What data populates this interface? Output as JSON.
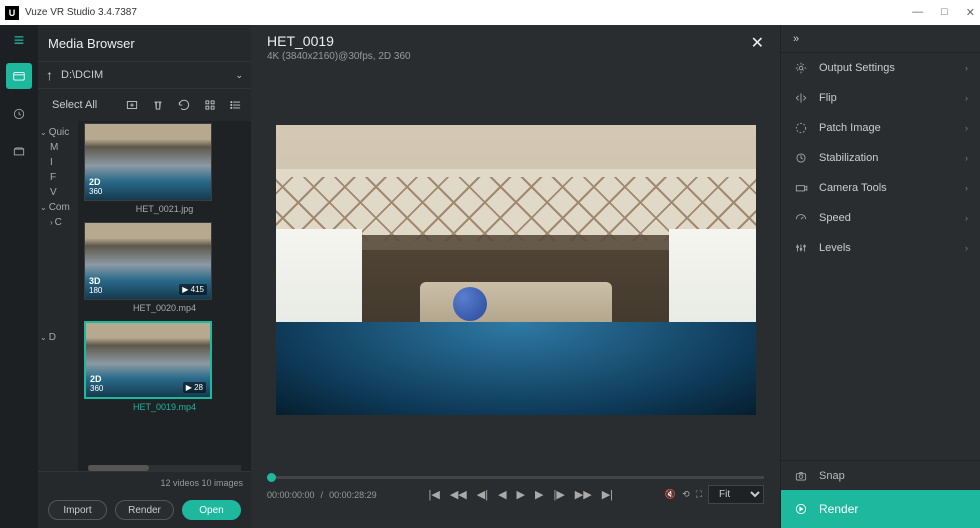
{
  "title_bar": {
    "app_name": "Vuze VR Studio 3.4.7387"
  },
  "browser": {
    "title": "Media Browser",
    "path": "D:\\DCIM",
    "select_all": "Select All",
    "tree": [
      "Quic",
      "M",
      "I",
      "F",
      "V",
      "Com",
      "C",
      "D"
    ],
    "thumbs": [
      {
        "name": "HET_0021.jpg",
        "badge": "2D",
        "sub": "360",
        "play": "",
        "sel": false
      },
      {
        "name": "HET_0020.mp4",
        "badge": "3D",
        "sub": "180",
        "play": "▶ 415",
        "sel": false
      },
      {
        "name": "HET_0019.mp4",
        "badge": "2D",
        "sub": "360",
        "play": "▶ 28",
        "sel": true
      }
    ],
    "footer": "12 videos  10 images",
    "import": "Import",
    "render": "Render",
    "open": "Open"
  },
  "viewer": {
    "title": "HET_0019",
    "subtitle": "4K (3840x2160)@30fps, 2D 360",
    "time_cur": "00:00:00:00",
    "time_dur": "00:00:28:29",
    "fit": "Fit"
  },
  "right": {
    "items": [
      {
        "icon": "gear",
        "label": "Output Settings"
      },
      {
        "icon": "flip",
        "label": "Flip"
      },
      {
        "icon": "patch",
        "label": "Patch Image"
      },
      {
        "icon": "stab",
        "label": "Stabilization"
      },
      {
        "icon": "cam",
        "label": "Camera Tools"
      },
      {
        "icon": "speed",
        "label": "Speed"
      },
      {
        "icon": "levels",
        "label": "Levels"
      }
    ],
    "snap": "Snap",
    "render": "Render"
  }
}
